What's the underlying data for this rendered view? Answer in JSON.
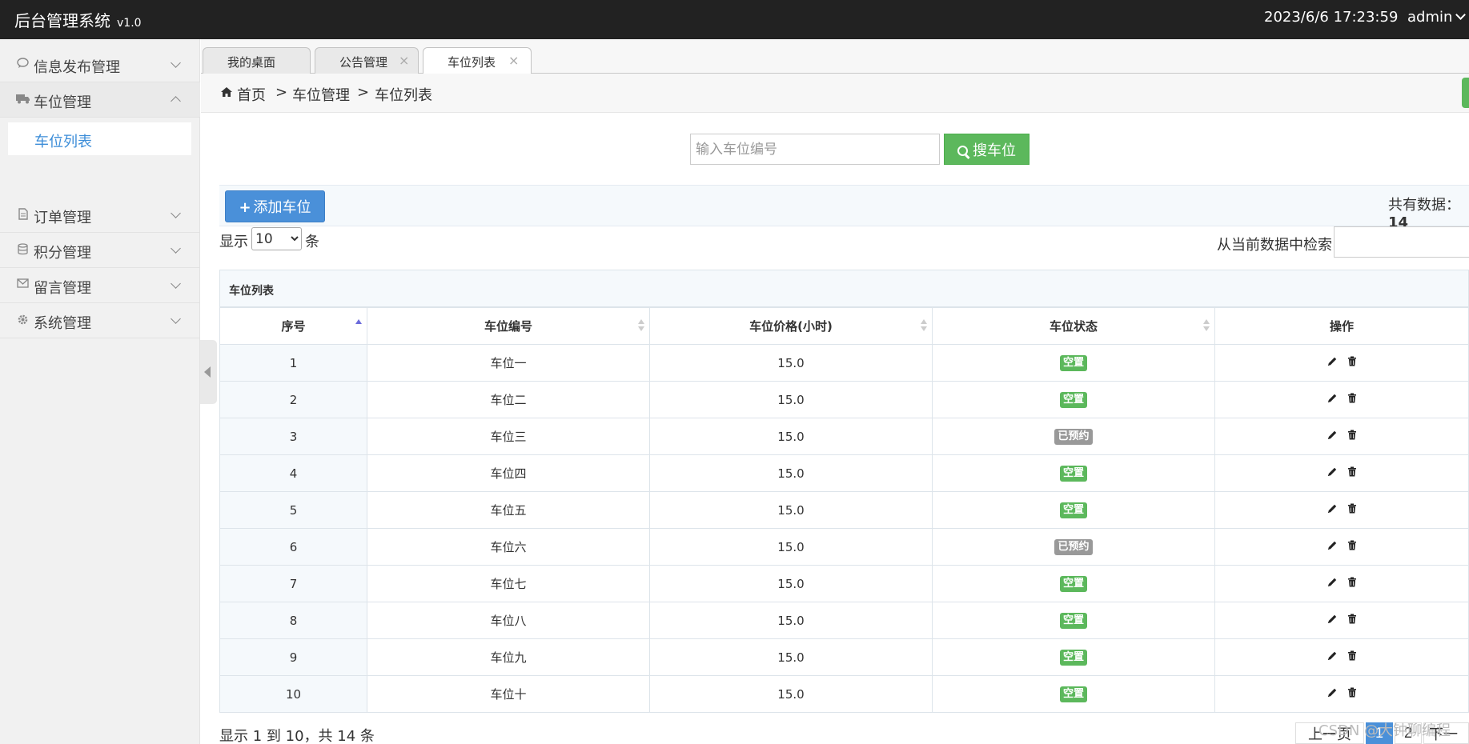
{
  "header": {
    "title": "后台管理系统",
    "version": "v1.0",
    "datetime": "2023/6/6 17:23:59",
    "user": "admin"
  },
  "sidebar": {
    "items": [
      {
        "label": "信息发布管理",
        "icon": "comment-icon",
        "expanded": false
      },
      {
        "label": "车位管理",
        "icon": "truck-icon",
        "expanded": true
      },
      {
        "label": "订单管理",
        "icon": "file-icon",
        "expanded": false
      },
      {
        "label": "积分管理",
        "icon": "database-icon",
        "expanded": false
      },
      {
        "label": "留言管理",
        "icon": "envelope-icon",
        "expanded": false
      },
      {
        "label": "系统管理",
        "icon": "gear-icon",
        "expanded": false
      }
    ],
    "subitem": "车位列表"
  },
  "tabs": [
    {
      "label": "我的桌面"
    },
    {
      "label": "公告管理"
    },
    {
      "label": "车位列表"
    }
  ],
  "breadcrumb": {
    "home": "首页",
    "sep": ">",
    "level1": "车位管理",
    "level2": "车位列表"
  },
  "search": {
    "placeholder": "输入车位编号",
    "button": "搜车位"
  },
  "toolbar": {
    "add_button": "添加车位",
    "total_label": "共有数据：",
    "total_count": "14"
  },
  "length": {
    "show": "显示",
    "value": "10",
    "unit": "条"
  },
  "filter": {
    "label": "从当前数据中检索:"
  },
  "table": {
    "title": "车位列表",
    "columns": [
      "序号",
      "车位编号",
      "车位价格(小时)",
      "车位状态",
      "操作"
    ],
    "rows": [
      {
        "seq": "1",
        "name": "车位一",
        "price": "15.0",
        "status": "空置",
        "status_type": "free"
      },
      {
        "seq": "2",
        "name": "车位二",
        "price": "15.0",
        "status": "空置",
        "status_type": "free"
      },
      {
        "seq": "3",
        "name": "车位三",
        "price": "15.0",
        "status": "已预约",
        "status_type": "reserved"
      },
      {
        "seq": "4",
        "name": "车位四",
        "price": "15.0",
        "status": "空置",
        "status_type": "free"
      },
      {
        "seq": "5",
        "name": "车位五",
        "price": "15.0",
        "status": "空置",
        "status_type": "free"
      },
      {
        "seq": "6",
        "name": "车位六",
        "price": "15.0",
        "status": "已预约",
        "status_type": "reserved"
      },
      {
        "seq": "7",
        "name": "车位七",
        "price": "15.0",
        "status": "空置",
        "status_type": "free"
      },
      {
        "seq": "8",
        "name": "车位八",
        "price": "15.0",
        "status": "空置",
        "status_type": "free"
      },
      {
        "seq": "9",
        "name": "车位九",
        "price": "15.0",
        "status": "空置",
        "status_type": "free"
      },
      {
        "seq": "10",
        "name": "车位十",
        "price": "15.0",
        "status": "空置",
        "status_type": "free"
      }
    ]
  },
  "footer": {
    "info": "显示 1 到 10，共 14 条",
    "prev": "上一页",
    "page1": "1",
    "page2": "2",
    "next": "下一页"
  },
  "watermark": "CSDN @大钟聊编程",
  "colors": {
    "header_bg": "#222222",
    "accent_blue": "#4a90d9",
    "success_green": "#5cb85c",
    "muted_gray": "#999999"
  }
}
